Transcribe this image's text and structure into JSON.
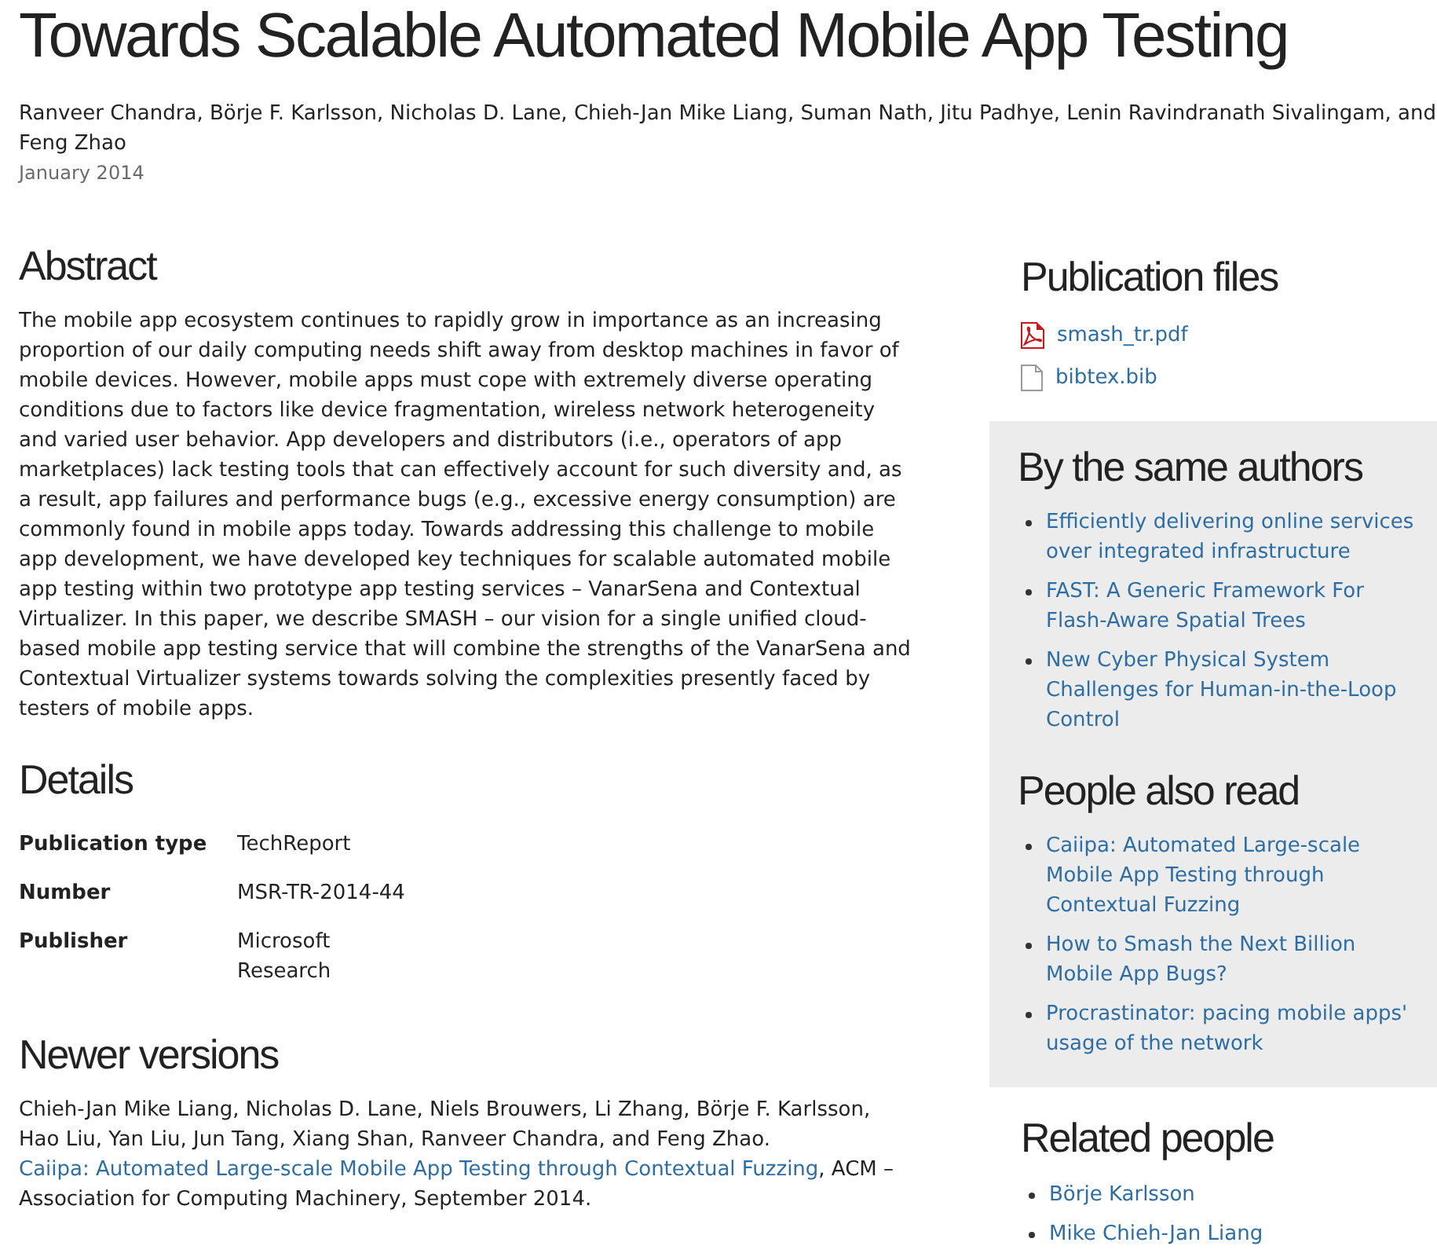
{
  "title": "Towards Scalable Automated Mobile App Testing",
  "authors": "Ranveer Chandra, Börje F. Karlsson, Nicholas D. Lane, Chieh-Jan Mike Liang, Suman Nath, Jitu Padhye, Lenin Ravindranath Sivalingam, and Feng Zhao",
  "date": "January 2014",
  "abstract": {
    "heading": "Abstract",
    "text": "The mobile app ecosystem continues to rapidly grow in importance as an increasing proportion of our daily computing needs shift away from desktop machines in favor of mobile devices. However, mobile apps must cope with extremely diverse operating conditions due to factors like device fragmentation, wireless network heterogeneity and varied user behavior. App developers and distributors (i.e., operators of app marketplaces) lack testing tools that can effectively account for such diversity and, as a result, app failures and performance bugs (e.g., excessive energy consumption) are commonly found in mobile apps today. Towards addressing this challenge to mobile app development, we have developed key techniques for scalable automated mobile app testing within two prototype app testing services – VanarSena and Contextual Virtualizer. In this paper, we describe SMASH – our vision for a single unified cloud-based mobile app testing service that will combine the strengths of the VanarSena and Contextual Virtualizer systems towards solving the complexities presently faced by testers of mobile apps."
  },
  "details": {
    "heading": "Details",
    "rows": [
      {
        "label": "Publication type",
        "value": "TechReport"
      },
      {
        "label": "Number",
        "value": "MSR-TR-2014-44"
      },
      {
        "label": "Publisher",
        "value": "Microsoft Research"
      }
    ]
  },
  "newer_versions": {
    "heading": "Newer versions",
    "text_before": "Chieh-Jan Mike Liang, Nicholas D. Lane, Niels Brouwers, Li Zhang, Börje F. Karlsson, Hao Liu, Yan Liu, Jun Tang, Xiang Shan, Ranveer Chandra, and Feng Zhao.",
    "link": "Caiipa: Automated Large-scale Mobile App Testing through Contextual Fuzzing",
    "text_after": ", ACM – Association for Computing Machinery, September 2014."
  },
  "publication_files": {
    "heading": "Publication files",
    "files": [
      {
        "name": "smash_tr.pdf",
        "kind": "pdf"
      },
      {
        "name": "bibtex.bib",
        "kind": "plain"
      }
    ]
  },
  "by_the_same_authors": {
    "heading": "By the same authors",
    "items": [
      "Efficiently delivering online services over integrated infrastructure",
      "FAST: A Generic Framework For Flash-Aware Spatial Trees",
      "New Cyber Physical System Challenges for Human-in-the-Loop Control"
    ]
  },
  "people_also_read": {
    "heading": "People also read",
    "items": [
      "Caiipa: Automated Large-scale Mobile App Testing through Contextual Fuzzing",
      "How to Smash the Next Billion Mobile App Bugs?",
      "Procrastinator: pacing mobile apps' usage of the network"
    ]
  },
  "related_people": {
    "heading": "Related people",
    "items": [
      "Börje Karlsson",
      "Mike Chieh-Jan Liang"
    ]
  }
}
